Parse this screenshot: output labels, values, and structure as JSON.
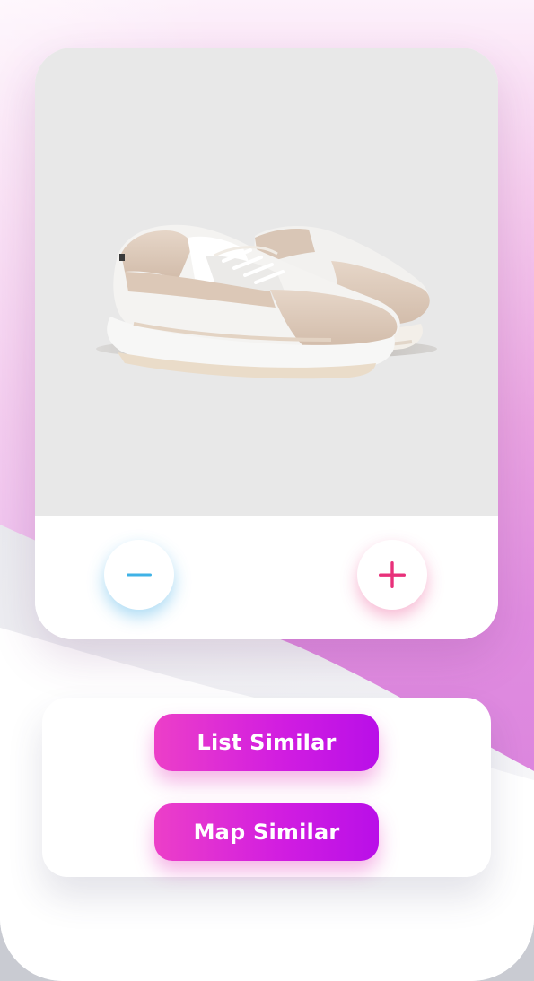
{
  "product": {
    "image_name": "white-beige-sneaker"
  },
  "quantity": {
    "decrement_icon": "minus-icon",
    "increment_icon": "plus-icon"
  },
  "actions": {
    "list_similar_label": "List Similar",
    "map_similar_label": "Map Similar"
  },
  "colors": {
    "accent_gradient_start": "#ec3fc8",
    "accent_gradient_end": "#b90fe8",
    "minus_color": "#3fb2e6",
    "plus_color": "#e8317a",
    "background_pink": "#e79ce0",
    "image_bg": "#e8e8e8"
  }
}
